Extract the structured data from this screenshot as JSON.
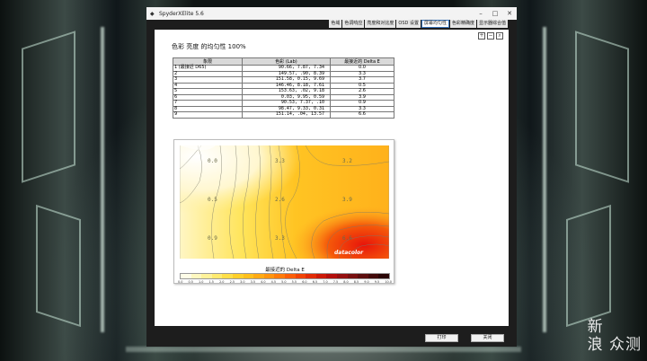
{
  "window": {
    "title": "SpyderXElite 5.6",
    "controls": {
      "minimize": "–",
      "maximize": "□",
      "close": "✕"
    }
  },
  "tabs": [
    {
      "label": "色域",
      "active": false
    },
    {
      "label": "色调响应",
      "active": false
    },
    {
      "label": "亮度和对比度",
      "active": false
    },
    {
      "label": "OSD 设置",
      "active": false
    },
    {
      "label": "屏幕均匀性",
      "active": true
    },
    {
      "label": "色彩精确度",
      "active": false
    },
    {
      "label": "显示器综合值",
      "active": false
    }
  ],
  "toolbar_icons": [
    "zoom-in-icon",
    "zoom-out-icon",
    "magnify-icon"
  ],
  "report": {
    "title": "色彩 亮度 的均匀性 100%",
    "table": {
      "headers": [
        "象限",
        "色彩 (Lab)",
        "最接近的 Delta E"
      ],
      "rows": [
        [
          "1 (最接近 D65)",
          "90.66,    7.87,    7.34",
          "0.0"
        ],
        [
          "2",
          "149.57,    .90,    8.39",
          "3.3"
        ],
        [
          "3",
          "151.58,    0.15,    9.69",
          "3.7"
        ],
        [
          "4",
          "146.46,    8.18,    7.61",
          "0.5"
        ],
        [
          "5",
          "153.63,    .02,    9.18",
          "2.6"
        ],
        [
          "6",
          "0.03,    9.95,    0.59",
          "3.9"
        ],
        [
          "7",
          "90.53,    7.37,    .10",
          "0.9"
        ],
        [
          "8",
          "98.47,    9.33,    0.31",
          "3.3"
        ],
        [
          "9",
          "151.14,    .04,   13.57",
          "6.6"
        ]
      ]
    }
  },
  "heatmap": {
    "cell_values": [
      "0.0",
      "3.3",
      "3.2",
      "0.5",
      "2.6",
      "3.9",
      "0.9",
      "3.3",
      "6.6"
    ],
    "brand": "datacolor",
    "scale_title": "最接近的 Delta E",
    "scale_ticks": [
      "0.0",
      "0.5",
      "1.0",
      "1.5",
      "2.0",
      "2.5",
      "3.0",
      "3.5",
      "4.0",
      "4.5",
      "5.0",
      "5.5",
      "6.0",
      "6.5",
      "7.0",
      "7.5",
      "8.0",
      "8.5",
      "9.0",
      "9.5",
      "10.0"
    ],
    "scale_colors": [
      "#fffde8",
      "#fff8c0",
      "#fff29a",
      "#ffea70",
      "#ffde48",
      "#ffcf2a",
      "#ffbf1c",
      "#ffaa14",
      "#ff940e",
      "#ff7a0a",
      "#fb5e08",
      "#f04406",
      "#e12c06",
      "#cc1a08",
      "#b30f0c",
      "#951010",
      "#781010",
      "#5c0e0e",
      "#420a0a",
      "#2a0606"
    ]
  },
  "buttons": {
    "print": "打印",
    "close": "关闭"
  },
  "watermark": "新\n浪 众测"
}
